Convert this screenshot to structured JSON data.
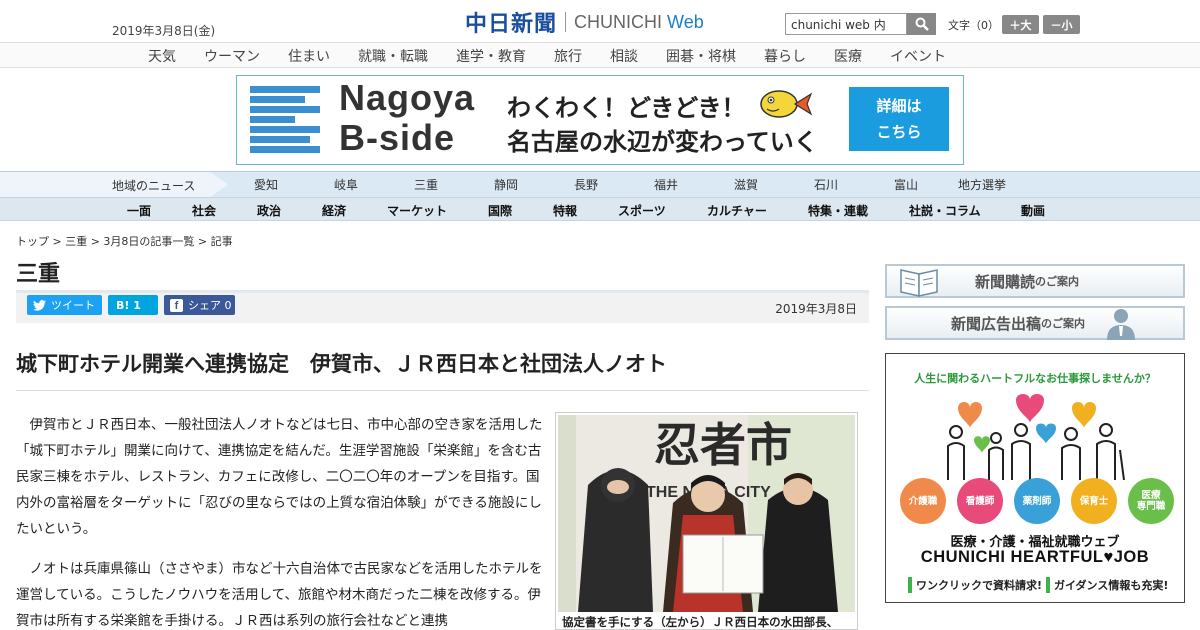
{
  "header": {
    "date": "2019年3月8日(金)",
    "logo_jp": "中日新聞",
    "logo_en_a": "CHUNICHI",
    "logo_en_b": "Web",
    "search_value": "chunichi web 内",
    "fontsize_label": "文字（0）",
    "fs_plus": "＋大",
    "fs_minus": "－小"
  },
  "nav_top": [
    "天気",
    "ウーマン",
    "住まい",
    "就職・転職",
    "進学・教育",
    "旅行",
    "相談",
    "囲碁・将棋",
    "暮らし",
    "医療",
    "イベント"
  ],
  "banner": {
    "title1": "Nagoya",
    "title2": "B-side",
    "line1": "わくわく！どきどき！",
    "line2": "名古屋の水辺が変わっていく",
    "btn1": "詳細は",
    "btn2": "こちら"
  },
  "nav_local": {
    "label": "地域のニュース",
    "items": [
      "愛知",
      "岐阜",
      "三重",
      "静岡",
      "長野",
      "福井",
      "滋賀",
      "石川",
      "富山",
      "地方選挙"
    ]
  },
  "nav_main": [
    "一面",
    "社会",
    "政治",
    "経済",
    "マーケット",
    "国際",
    "特報",
    "スポーツ",
    "カルチャー",
    "特集・連載",
    "社説・コラム",
    "動画"
  ],
  "breadcrumb": "トップ > 三重 > 3月8日の記事一覧 > 記事",
  "section_title": "三重",
  "share": {
    "tweet": "ツイート",
    "hatena": "B! 1",
    "facebook": "シェア 0"
  },
  "article": {
    "date": "2019年3月8日",
    "headline": "城下町ホテル開業へ連携協定　伊賀市、ＪＲ西日本と社団法人ノオト",
    "paragraphs": [
      "伊賀市とＪＲ西日本、一般社団法人ノオトなどは七日、市中心部の空き家を活用した「城下町ホテル」開業に向けて、連携協定を結んだ。生涯学習施設「栄楽館」を含む古民家三棟をホテル、レストラン、カフェに改修し、二〇二〇年のオープンを目指す。国内外の富裕層をターゲットに「忍びの里ならではの上質な宿泊体験」ができる施設にしたいという。",
      "ノオトは兵庫県篠山（ささやま）市など十六自治体で古民家などを活用したホテルを運営している。こうしたノウハウを活用して、旅館や材木商だった二棟を改修する。伊賀市は所有する栄楽館を手掛ける。ＪＲ西は系列の旅行会社などと連携"
    ],
    "photo_sign": "忍者市",
    "photo_sub": "THE NINJA CITY",
    "caption": "協定書を手にする（左から）ＪＲ西日本の水田部長、"
  },
  "sidebar": {
    "btn1_main": "新聞購読",
    "btn1_sub": "のご案内",
    "btn2_main": "新聞広告出稿",
    "btn2_sub": "のご案内"
  },
  "ad": {
    "tagline": "人生に関わるハートフルなお仕事探しませんか？",
    "bubbles": [
      "介護職",
      "看護師",
      "薬剤師",
      "保育士",
      "医療\n専門職"
    ],
    "line1": "医療・介護・福祉就職ウェブ",
    "line2": "CHUNICHI HEARTFUL♥JOB",
    "cta1": "ワンクリックで資料請求!",
    "cta2": "ガイダンス情報も充実!"
  },
  "colors": {
    "brand_blue": "#1a4fa0",
    "twitter": "#1da1f2",
    "hatena": "#00a4de",
    "facebook": "#3b5998",
    "banner_button": "#1a9cde"
  }
}
